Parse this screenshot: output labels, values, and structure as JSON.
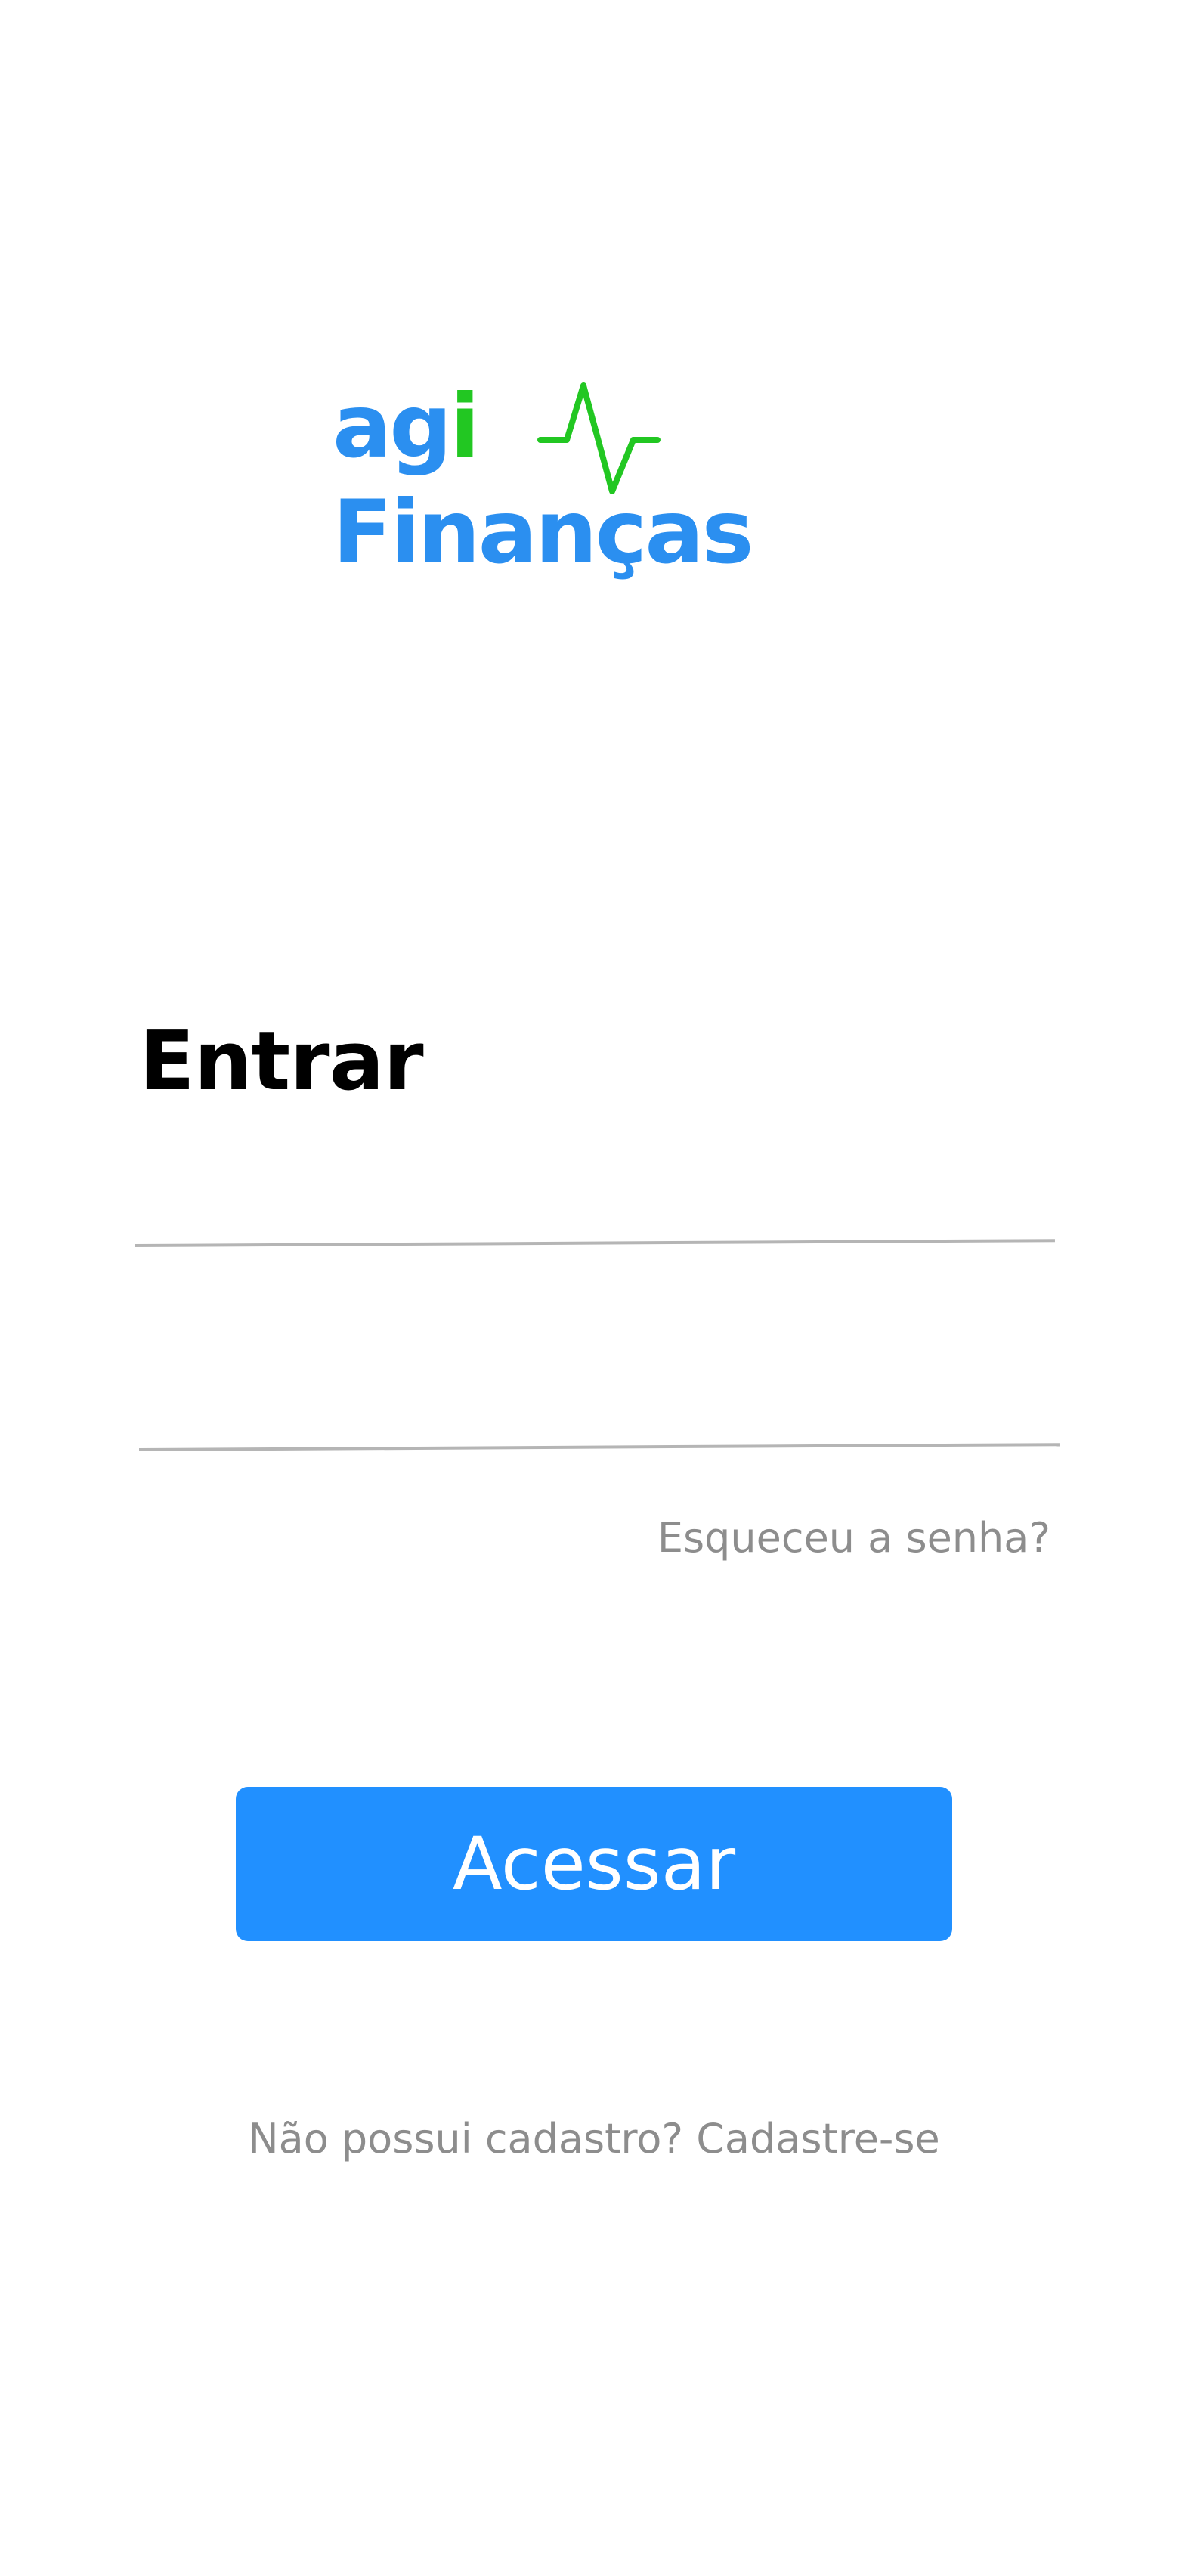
{
  "logo": {
    "brand_prefix": "ag",
    "brand_i": "i",
    "brand_name": "Finanças",
    "icon": "pulse-icon",
    "colors": {
      "primary": "#2b8ff0",
      "accent": "#22c722"
    }
  },
  "login": {
    "title": "Entrar",
    "username_placeholder": "",
    "password_placeholder": "",
    "forgot_password_label": "Esqueceu a senha?",
    "submit_label": "Acessar",
    "signup_prompt": "Não possui cadastro?",
    "signup_link": "Cadastre-se"
  },
  "colors": {
    "button": "#2190ff",
    "muted_text": "#8d8d8d",
    "field_line": "#b5b5b5"
  }
}
